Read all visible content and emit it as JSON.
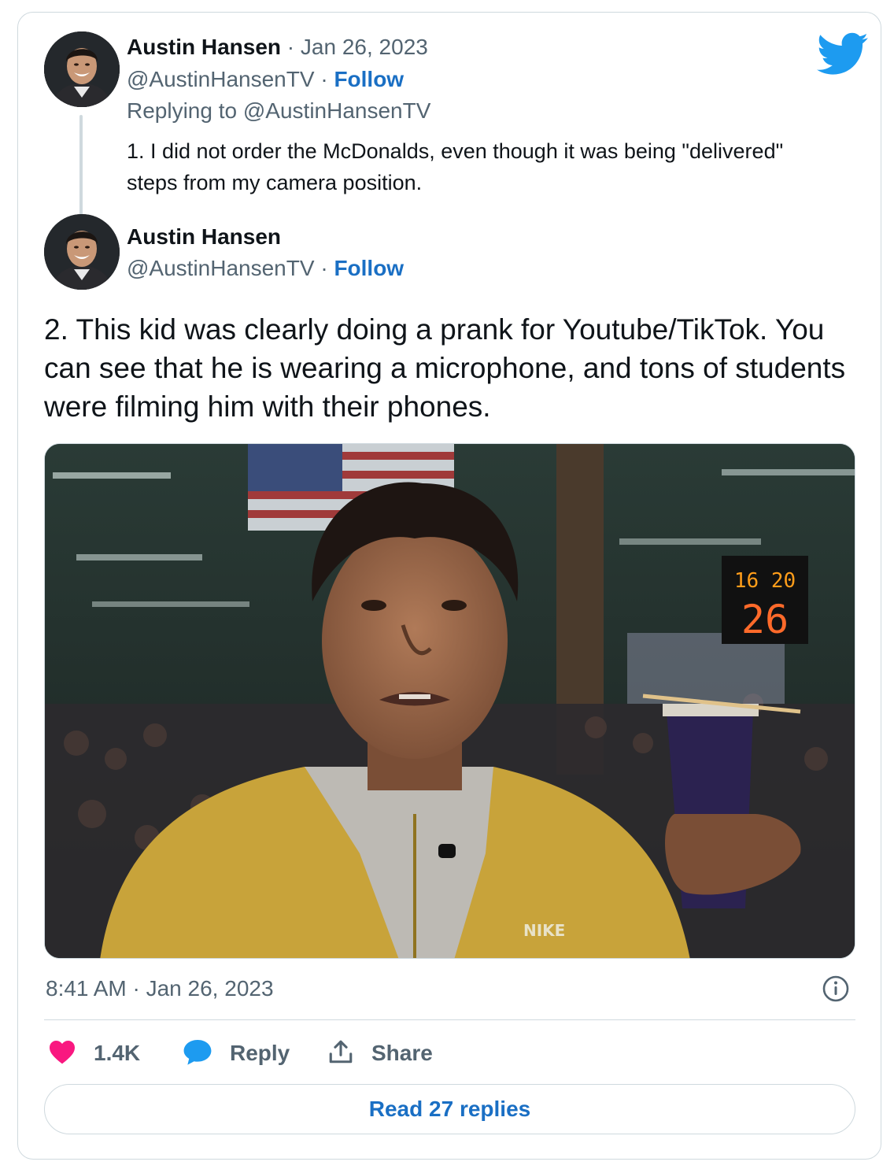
{
  "tweet_parent": {
    "author_name": "Austin Hansen",
    "separator": " · ",
    "date": "Jan 26, 2023",
    "handle": "@AustinHansenTV",
    "handle_separator": " · ",
    "follow_label": "Follow",
    "replying_prefix": "Replying to ",
    "replying_handle": "@AustinHansenTV",
    "text": "1. I did not order the McDonalds, even though it was being \"delivered\" steps from my camera position."
  },
  "tweet_main": {
    "author_name": "Austin Hansen",
    "handle": "@AustinHansenTV",
    "handle_separator": " · ",
    "follow_label": "Follow",
    "text": "2. This kid was clearly doing a prank for Youtube/TikTok. You can see that he is wearing a microphone, and tons of students were filming him with their phones.",
    "media": {
      "scoreboard_top": "16 20",
      "scoreboard_bottom": "26",
      "jacket_brand": "NIKE"
    },
    "timestamp": "8:41 AM · Jan 26, 2023"
  },
  "actions": {
    "like_count": "1.4K",
    "reply_label": "Reply",
    "share_label": "Share"
  },
  "read_replies_label": "Read 27 replies",
  "icons": {
    "brand": "twitter-bird-icon",
    "info": "info-icon",
    "like": "heart-icon",
    "reply": "speech-bubble-icon",
    "share": "share-upload-icon"
  },
  "colors": {
    "twitter_blue": "#1d9bf0",
    "like_pink": "#f91880",
    "muted_text": "#536471",
    "border": "#cfd9de"
  }
}
